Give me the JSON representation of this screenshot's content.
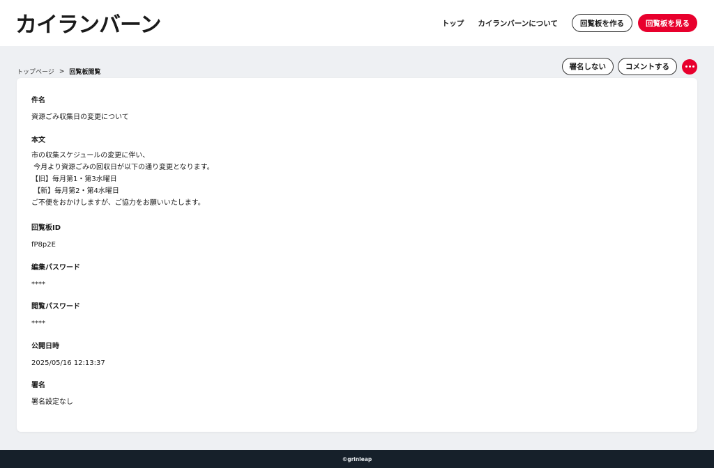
{
  "header": {
    "logo": "カイランバーン",
    "nav": {
      "top": "トップ",
      "about": "カイランバーンについて",
      "create": "回覧板を作る",
      "view": "回覧板を見る"
    }
  },
  "breadcrumb": {
    "home": "トップページ",
    "separator": ">",
    "current": "回覧板閲覧"
  },
  "actions": {
    "no_sign": "署名しない",
    "comment": "コメントする",
    "more_icon": "ellipsis-icon"
  },
  "fields": [
    {
      "label": "件名",
      "value": "資源ごみ収集日の変更について"
    },
    {
      "label": "本文",
      "value": "市の収集スケジュールの変更に伴い、\n 今月より資源ごみの回収日が以下の通り変更となります。\n【旧】毎月第1・第3水曜日\n 【新】毎月第2・第4水曜日\nご不便をおかけしますが、ご協力をお願いいたします。"
    },
    {
      "label": "回覧板ID",
      "value": "fP8p2E"
    },
    {
      "label": "編集パスワード",
      "value": "****"
    },
    {
      "label": "閲覧パスワード",
      "value": "****"
    },
    {
      "label": "公開日時",
      "value": "2025/05/16 12:13:37"
    },
    {
      "label": "署名",
      "value": "署名設定なし"
    }
  ],
  "footer": {
    "copyright": "©grinleap"
  },
  "colors": {
    "accent": "#e8002d",
    "background": "#eef0f3",
    "footer": "#16202a"
  }
}
